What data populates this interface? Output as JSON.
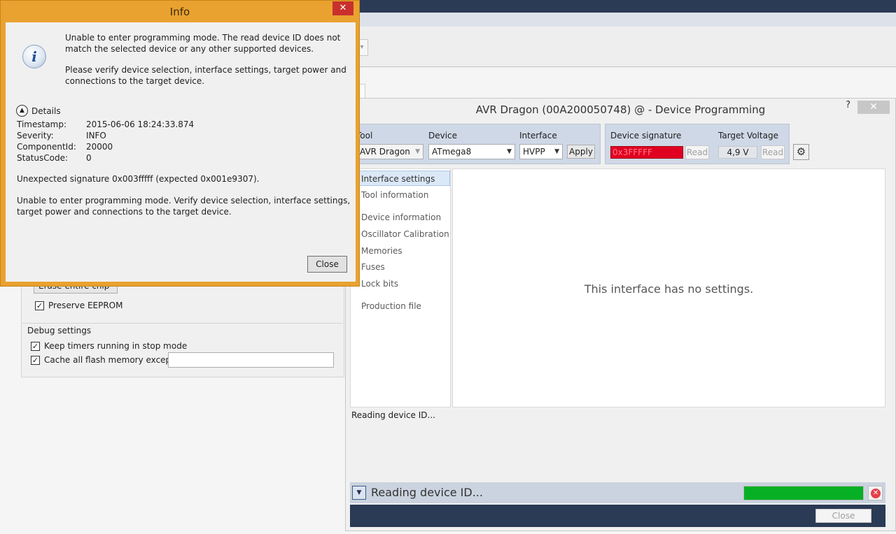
{
  "info_dialog": {
    "title": "Info",
    "close_x": "✕",
    "message": "Unable to enter programming mode. The read device ID does not match the selected device or any other supported devices.",
    "hint": "Please verify device selection, interface settings, target power and connections to the target device.",
    "details_label": "Details",
    "details": [
      {
        "key": "Timestamp:",
        "value": "2015-06-06 18:24:33.874"
      },
      {
        "key": "Severity:",
        "value": "INFO"
      },
      {
        "key": "ComponentId:",
        "value": "20000"
      },
      {
        "key": "StatusCode:",
        "value": "0"
      }
    ],
    "signature_msg": "Unexpected signature 0x003fffff (expected 0x001e9307).",
    "long_msg": "Unable to enter programming mode. Verify device selection, interface settings, target power and connections to the target device.",
    "close_label": "Close"
  },
  "background": {
    "erase_label": "Erase entire chip",
    "preserve_eeprom": "Preserve EEPROM",
    "debug_settings": "Debug settings",
    "keep_timers": "Keep timers running in stop mode",
    "cache_flash": "Cache all flash memory except",
    "cache_value": ""
  },
  "device_programming": {
    "title": "AVR Dragon (00A200050748) @  - Device Programming",
    "help": "?",
    "close_x": "✕",
    "tool_label": "Tool",
    "tool_value": "AVR Dragon",
    "device_label": "Device",
    "device_value": "ATmega8",
    "interface_label": "Interface",
    "interface_value": "HVPP",
    "apply": "Apply",
    "signature_label": "Device signature",
    "signature_value": "0x3FFFFF",
    "read": "Read",
    "voltage_label": "Target Voltage",
    "voltage_value": "4,9 V",
    "nav": [
      "Interface settings",
      "Tool information",
      "Device information",
      "Oscillator Calibration",
      "Memories",
      "Fuses",
      "Lock bits",
      "Production file"
    ],
    "content_msg": "This interface has no settings.",
    "log_text": "Reading device ID...",
    "status_text": "Reading device ID...",
    "progress": 1.0,
    "footer_close": "Close"
  },
  "colors": {
    "dialog_border": "#e9a22f",
    "signature_error": "#e00020",
    "progress": "#06b025",
    "footer": "#2b3a55"
  }
}
